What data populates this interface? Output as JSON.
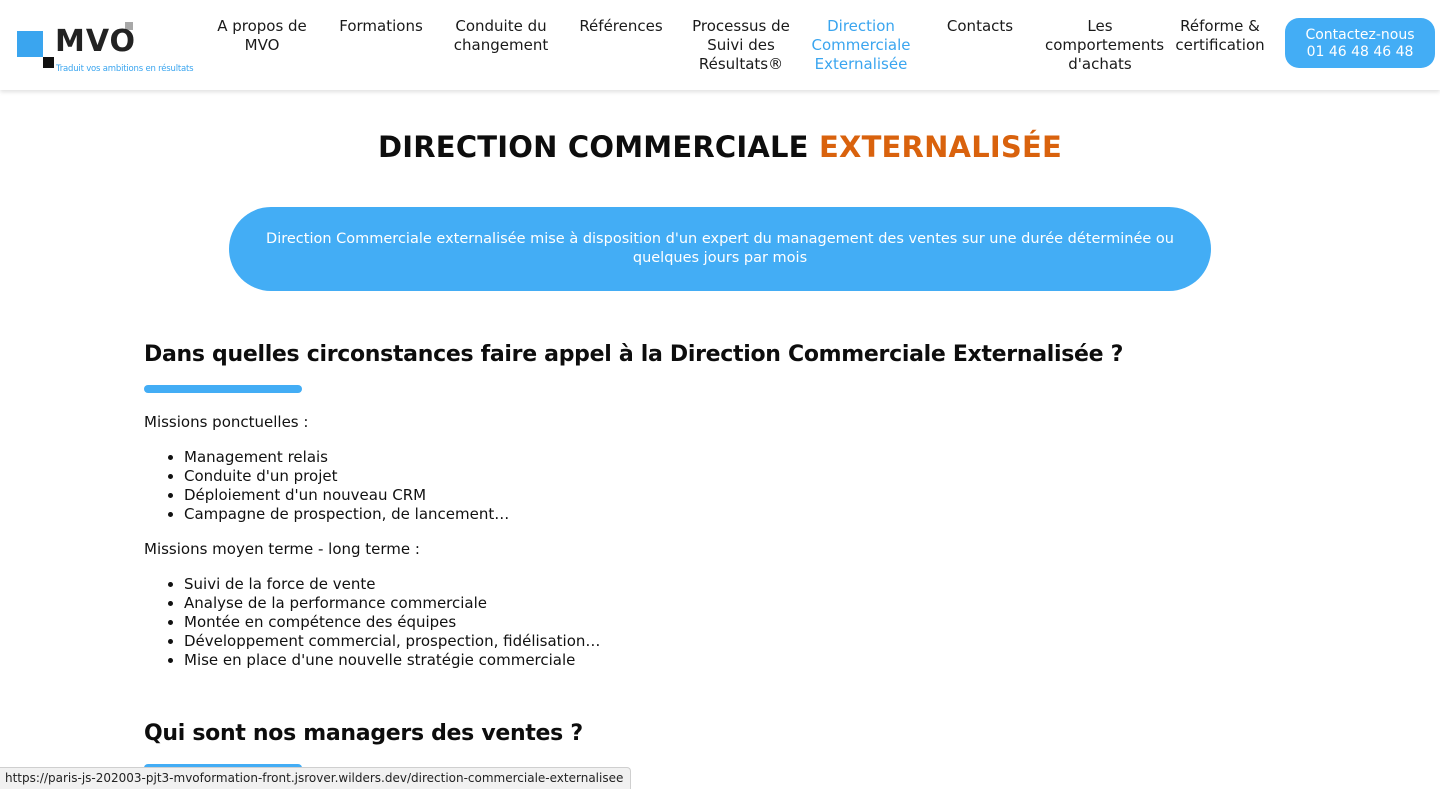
{
  "header": {
    "logo": {
      "brand": "MVO",
      "tagline": "Traduit vos ambitions en résultats"
    },
    "nav": [
      {
        "label": "A propos de MVO",
        "active": false
      },
      {
        "label": "Formations",
        "active": false
      },
      {
        "label": "Conduite du changement",
        "active": false
      },
      {
        "label": "Références",
        "active": false
      },
      {
        "label": "Processus de Suivi des Résultats®",
        "active": false
      },
      {
        "label": "Direction Commerciale Externalisée",
        "active": true
      },
      {
        "label": "Contacts",
        "active": false
      },
      {
        "label": "Les comportements d'achats",
        "active": false
      },
      {
        "label": "Réforme & certification",
        "active": false
      }
    ],
    "contact_button": {
      "line1": "Contactez-nous",
      "line2": "01 46 48 46 48"
    }
  },
  "main": {
    "title_part1": "DIRECTION COMMERCIALE",
    "title_part2": "EXTERNALISÉE",
    "banner": "Direction Commerciale externalisée mise à disposition d'un expert du management des ventes sur une durée déterminée ou quelques jours par mois",
    "section1": {
      "heading": "Dans quelles circonstances faire appel à la Direction Commerciale Externalisée ?",
      "intro_short": "Missions ponctuelles :",
      "short_items": [
        "Management relais",
        "Conduite d'un projet",
        "Déploiement d'un nouveau CRM",
        "Campagne de prospection, de lancement…"
      ],
      "intro_long": "Missions moyen terme - long terme :",
      "long_items": [
        "Suivi de la force de vente",
        "Analyse de la performance commerciale",
        "Montée en compétence des équipes",
        "Développement commercial, prospection, fidélisation…",
        "Mise en place d'une nouvelle stratégie commerciale"
      ]
    },
    "section2": {
      "heading": "Qui sont nos managers des ventes ?"
    }
  },
  "statusbar": {
    "url": "https://paris-js-202003-pjt3-mvoformation-front.jsrover.wilders.dev/direction-commerciale-externalisee"
  },
  "colors": {
    "accent_blue": "#43adf5",
    "accent_orange": "#d9620d",
    "logo_blue": "#3aa5ef"
  }
}
